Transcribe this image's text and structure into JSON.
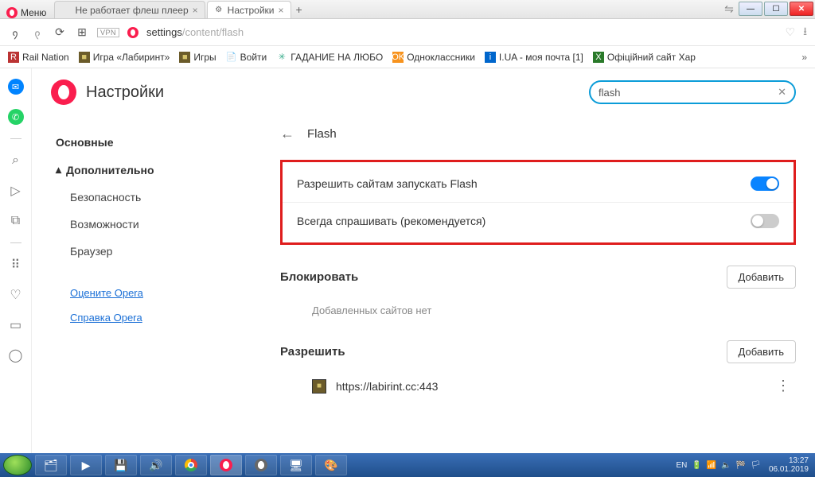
{
  "window": {
    "menu_label": "Меню",
    "tabs": [
      {
        "label": "Не работает флеш плеер",
        "active": false
      },
      {
        "label": "Настройки",
        "active": true
      }
    ]
  },
  "addressbar": {
    "vpn": "VPN",
    "url_prefix": "settings",
    "url_suffix": "/content/flash"
  },
  "bookmarks": [
    "Rail Nation",
    "Игра «Лабиринт»",
    "Игры",
    "Войти",
    "ГАДАНИЕ НА ЛЮБО",
    "Одноклассники",
    "I.UA - моя почта [1]",
    "Офіційний сайт Хар"
  ],
  "settings": {
    "title": "Настройки",
    "search_value": "flash",
    "nav": {
      "basic": "Основные",
      "advanced": "Дополнительно",
      "security": "Безопасность",
      "features": "Возможности",
      "browser": "Браузер",
      "rate_link": "Оцените Opera",
      "help_link": "Справка Opera"
    },
    "detail": {
      "heading": "Flash",
      "allow_label": "Разрешить сайтам запускать Flash",
      "ask_label": "Всегда спрашивать (рекомендуется)",
      "block_title": "Блокировать",
      "allow_title": "Разрешить",
      "add_btn": "Добавить",
      "empty_text": "Добавленных сайтов нет",
      "allowed_site": "https://labirint.cc:443"
    }
  },
  "taskbar": {
    "lang": "EN",
    "time": "13:27",
    "date": "06.01.2019"
  }
}
